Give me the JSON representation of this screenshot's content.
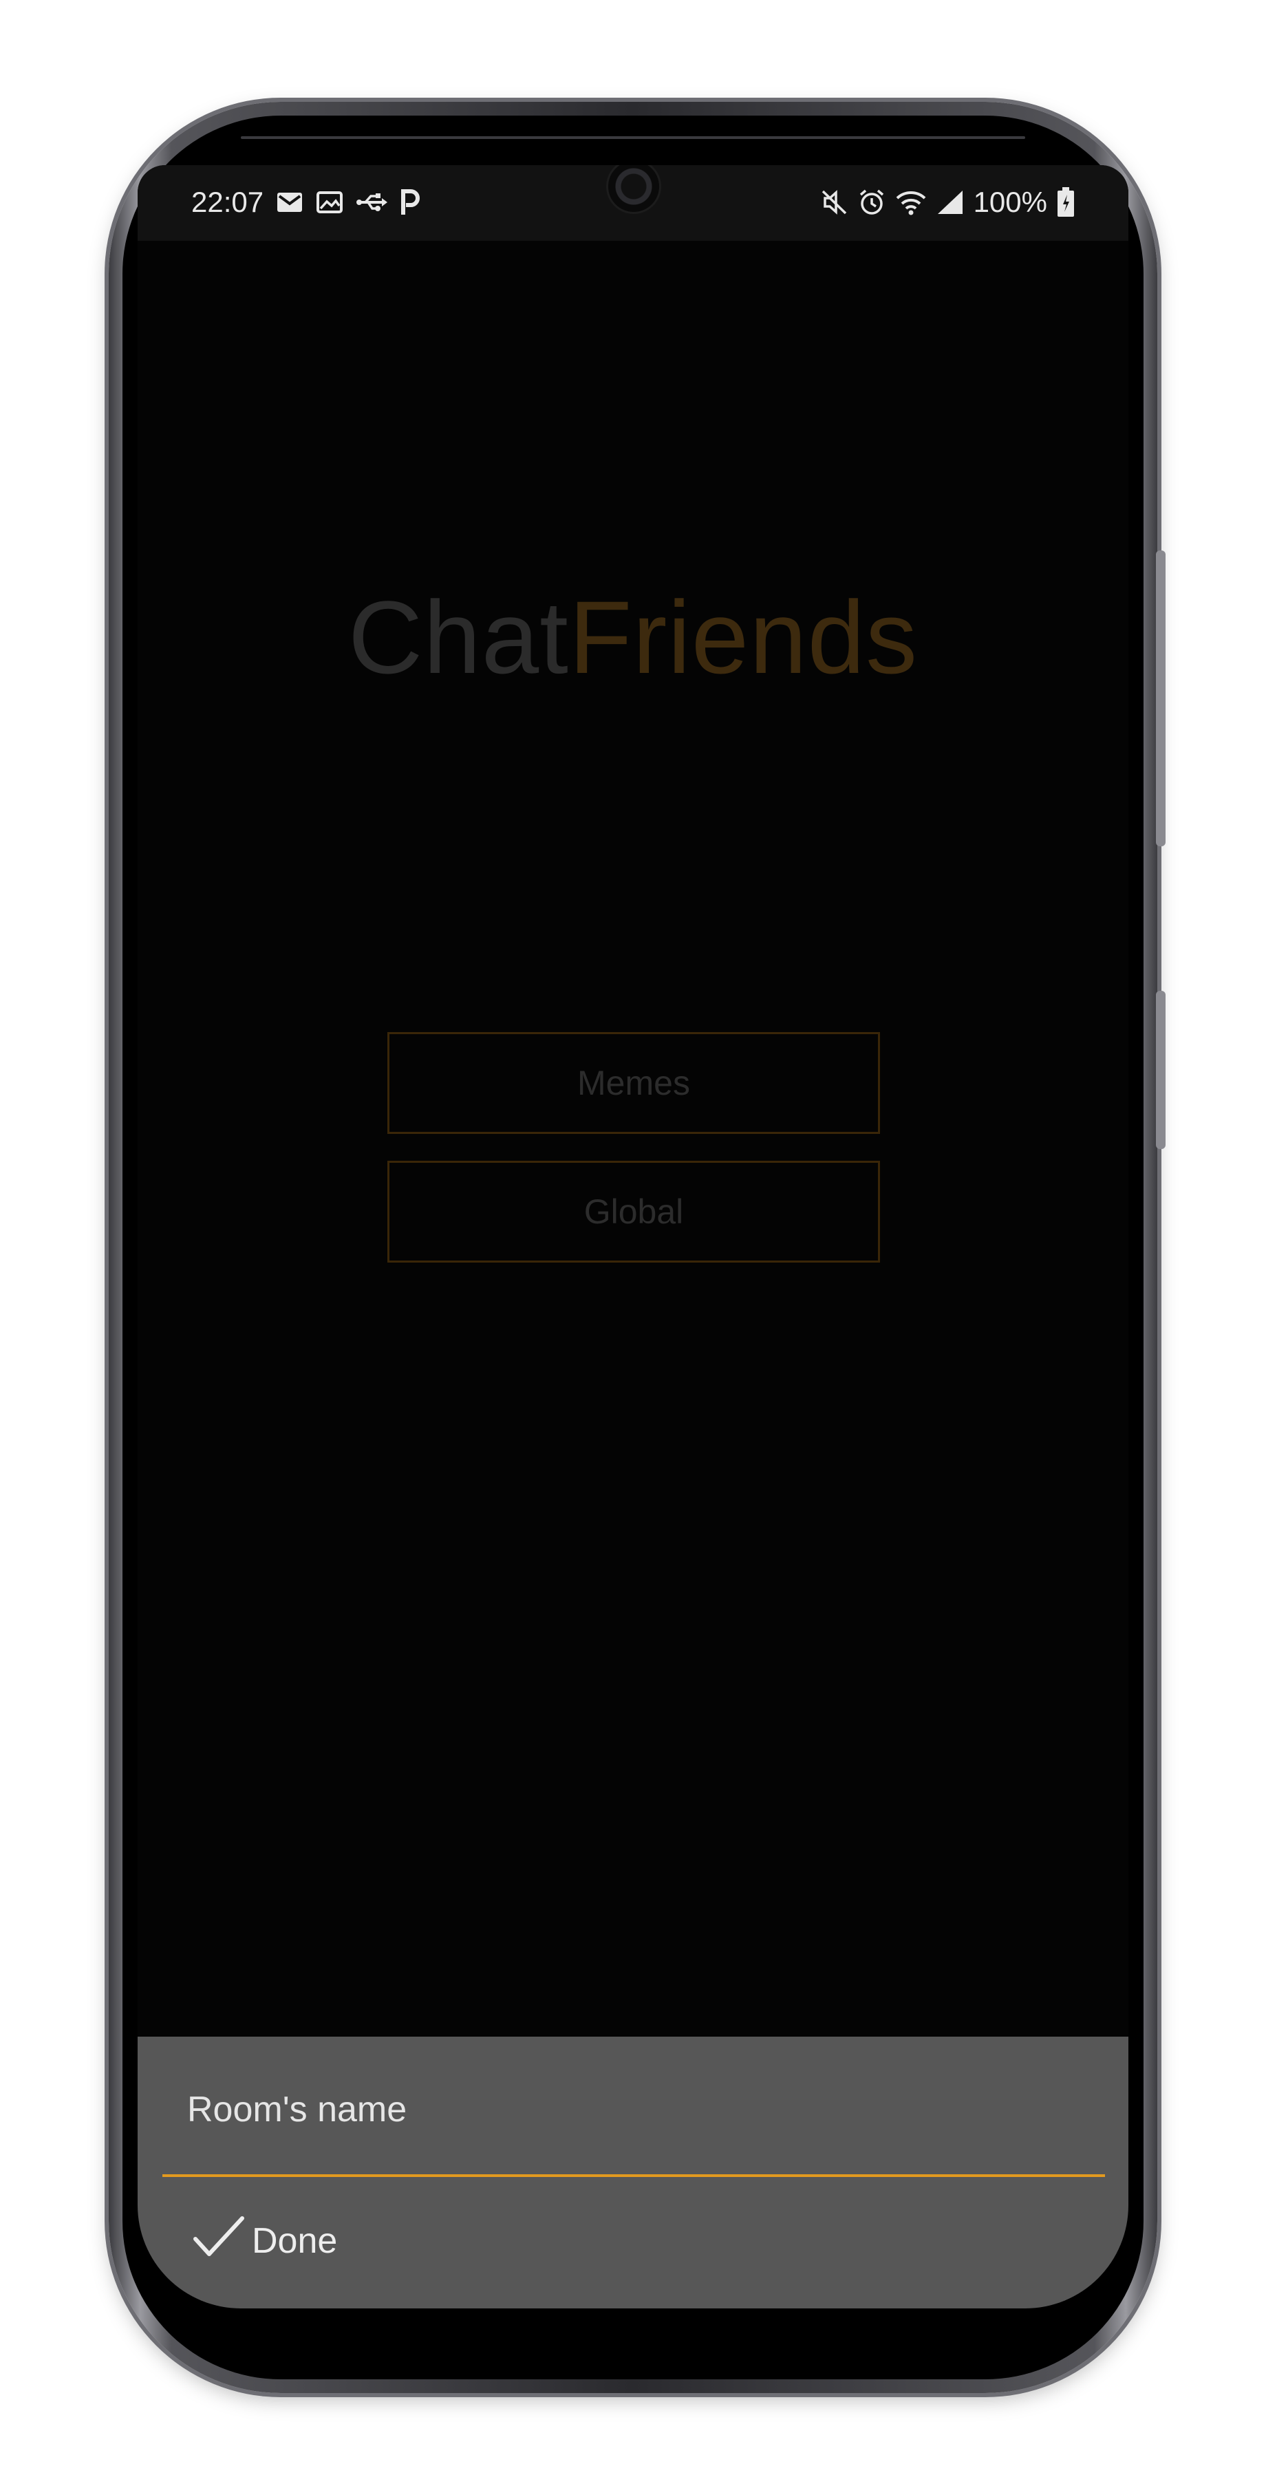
{
  "status_bar": {
    "time": "22:07",
    "left_icons": [
      "gmail-icon",
      "gallery-icon",
      "usb-icon",
      "parking-icon"
    ],
    "right_icons": [
      "mute-icon",
      "alarm-icon",
      "wifi-icon",
      "signal-icon"
    ],
    "battery": "100%"
  },
  "app": {
    "title_part1": "Chat",
    "title_part2": "Friends",
    "title_color1": "#2b2b2b",
    "title_color2": "#3d2a0e"
  },
  "rooms": [
    {
      "label": "Memes"
    },
    {
      "label": "Global"
    }
  ],
  "input_sheet": {
    "placeholder": "Room's name",
    "done_label": "Done",
    "accent_color": "#e29a1f"
  }
}
